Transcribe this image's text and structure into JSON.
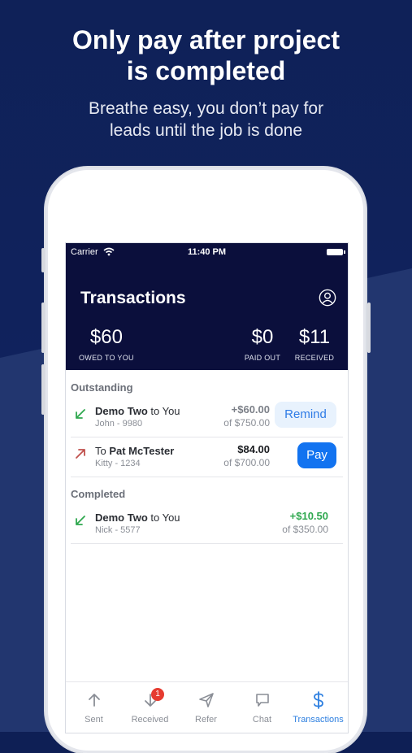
{
  "promo": {
    "headline_line1": "Only pay after project",
    "headline_line2": "is completed",
    "subtitle_line1": "Breathe easy, you don’t pay for",
    "subtitle_line2": "leads until the job is done"
  },
  "status_bar": {
    "carrier": "Carrier",
    "time": "11:40 PM"
  },
  "header": {
    "title": "Transactions",
    "stats": [
      {
        "value": "$60",
        "label": "OWED TO YOU"
      },
      {
        "value": "$0",
        "label": "PAID OUT"
      },
      {
        "value": "$11",
        "label": "RECEIVED"
      }
    ]
  },
  "outstanding": {
    "label": "Outstanding",
    "rows": [
      {
        "name_bold": "Demo Two",
        "name_rest": " to You",
        "sub": "John - 9980",
        "amount": "+$60.00",
        "of": "of $750.00",
        "action": "Remind"
      },
      {
        "name_prefix": "To ",
        "name_bold": "Pat McTester",
        "sub": "Kitty - 1234",
        "amount": "$84.00",
        "of": "of $700.00",
        "action": "Pay"
      }
    ]
  },
  "completed": {
    "label": "Completed",
    "rows": [
      {
        "name_bold": "Demo Two",
        "name_rest": " to You",
        "sub": "Nick - 5577",
        "amount": "+$10.50",
        "of": "of $350.00"
      }
    ]
  },
  "tabs": [
    {
      "label": "Sent",
      "icon": "arrow-up-icon"
    },
    {
      "label": "Received",
      "icon": "arrow-down-icon",
      "badge": "1"
    },
    {
      "label": "Refer",
      "icon": "paper-plane-icon"
    },
    {
      "label": "Chat",
      "icon": "chat-bubble-icon"
    },
    {
      "label": "Transactions",
      "icon": "dollar-icon",
      "active": true
    }
  ],
  "colors": {
    "background": "#0e1f55",
    "header": "#0b0f3c",
    "accent_blue": "#1273f0",
    "positive_green": "#2fa84f",
    "outgoing_red": "#c0504d",
    "badge_red": "#e63b30"
  }
}
